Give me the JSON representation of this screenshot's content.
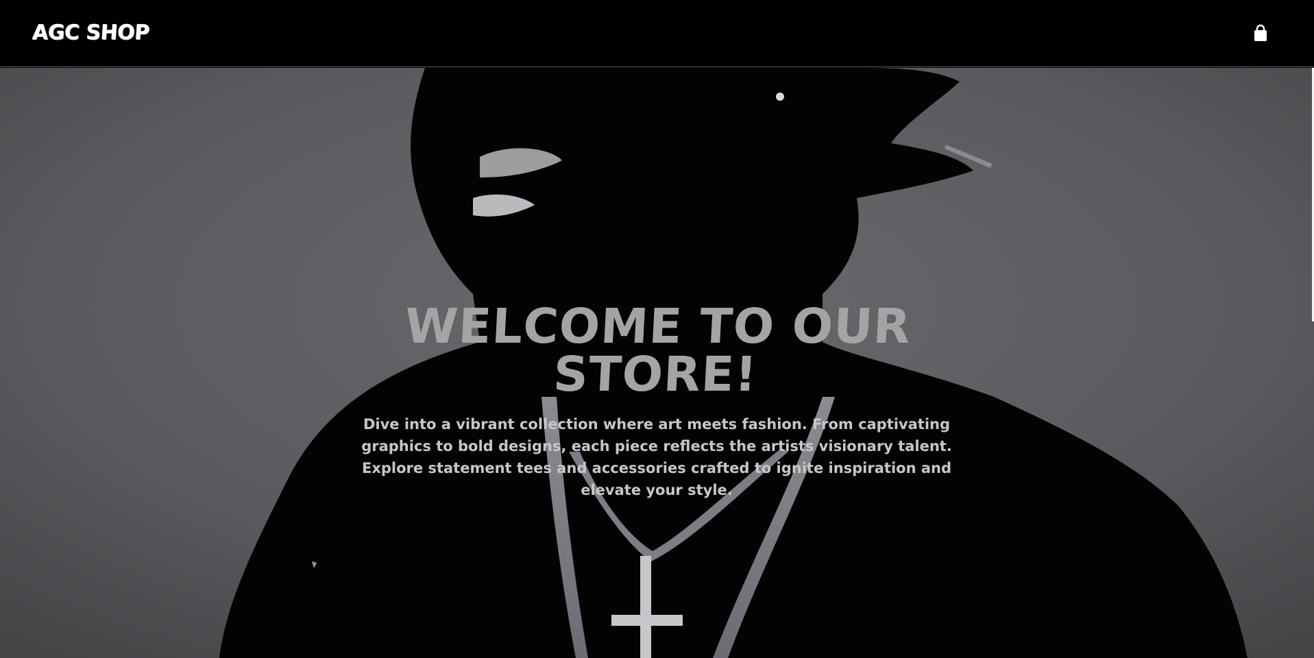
{
  "navbar": {
    "brand": "AGC SHOP",
    "cart_icon": "shopping-bag-icon"
  },
  "hero": {
    "title": "WELCOME TO OUR STORE!",
    "description": "Dive into a vibrant collection where art meets fashion. From captivating graphics to bold designs, each piece reflects the artists visionary talent. Explore statement tees and accessories crafted to ignite inspiration and elevate your style."
  },
  "colors": {
    "navbar_bg": "#000000",
    "brand_text": "#ffffff",
    "hero_title": "#a4a4a4",
    "hero_text": "#c7c7c7",
    "hero_backdrop": "#5b5a5c"
  }
}
